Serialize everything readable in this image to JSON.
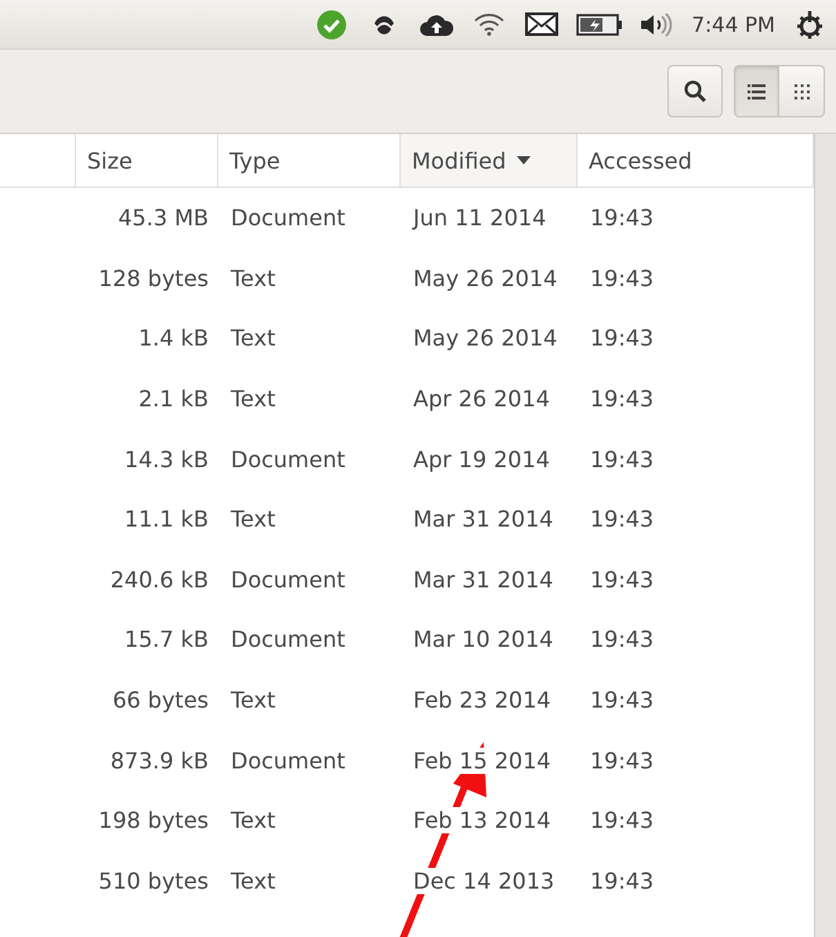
{
  "top_bar": {
    "clock": "7:44 PM"
  },
  "toolbar": {
    "view_buttons": [
      {
        "kind": "list",
        "selected": true
      },
      {
        "kind": "grid",
        "selected": false
      }
    ]
  },
  "table": {
    "columns": [
      {
        "label": "Size",
        "sorted": false
      },
      {
        "label": "Type",
        "sorted": false
      },
      {
        "label": "Modified",
        "sorted": true
      },
      {
        "label": "Accessed",
        "sorted": false
      }
    ],
    "rows": [
      {
        "size": "45.3 MB",
        "type": "Document",
        "modified": "Jun 11 2014",
        "accessed": "19:43"
      },
      {
        "size": "128 bytes",
        "type": "Text",
        "modified": "May 26 2014",
        "accessed": "19:43"
      },
      {
        "size": "1.4 kB",
        "type": "Text",
        "modified": "May 26 2014",
        "accessed": "19:43"
      },
      {
        "size": "2.1 kB",
        "type": "Text",
        "modified": "Apr 26 2014",
        "accessed": "19:43"
      },
      {
        "size": "14.3 kB",
        "type": "Document",
        "modified": "Apr 19 2014",
        "accessed": "19:43"
      },
      {
        "size": "11.1 kB",
        "type": "Text",
        "modified": "Mar 31 2014",
        "accessed": "19:43"
      },
      {
        "size": "240.6 kB",
        "type": "Document",
        "modified": "Mar 31 2014",
        "accessed": "19:43"
      },
      {
        "size": "15.7 kB",
        "type": "Document",
        "modified": "Mar 10 2014",
        "accessed": "19:43"
      },
      {
        "size": "66 bytes",
        "type": "Text",
        "modified": "Feb 23 2014",
        "accessed": "19:43"
      },
      {
        "size": "873.9 kB",
        "type": "Document",
        "modified": "Feb 15 2014",
        "accessed": "19:43"
      },
      {
        "size": "198 bytes",
        "type": "Text",
        "modified": "Feb 13 2014",
        "accessed": "19:43"
      },
      {
        "size": "510 bytes",
        "type": "Text",
        "modified": "Dec 14 2013",
        "accessed": "19:43"
      }
    ]
  }
}
